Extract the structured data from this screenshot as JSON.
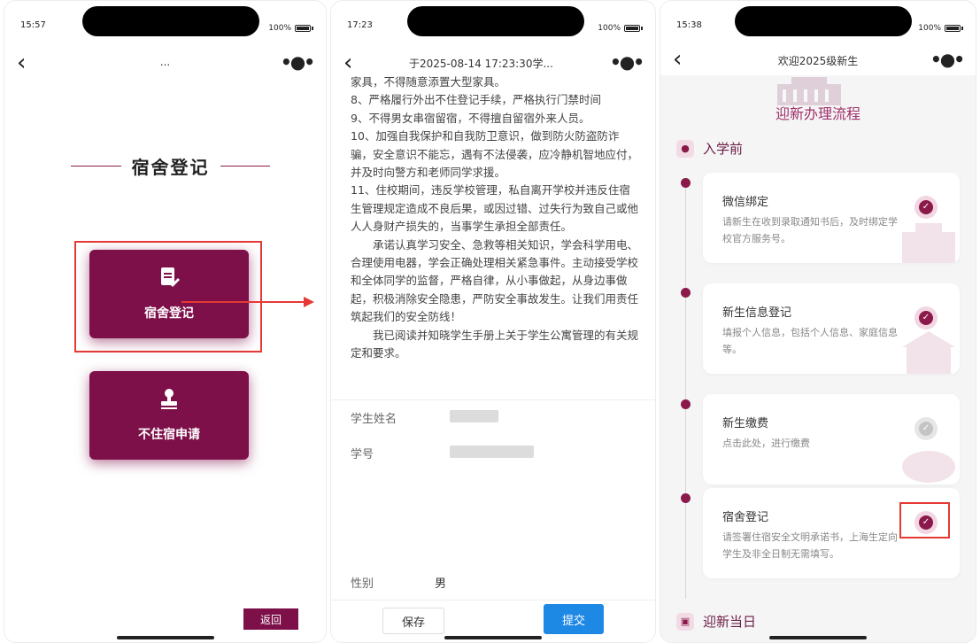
{
  "phone1": {
    "time": "15:57",
    "battery": "100%",
    "nav_title": "...",
    "section_title": "宿舍登记",
    "tiles": [
      {
        "label": "宿舍登记",
        "icon": "edit-doc-icon"
      },
      {
        "label": "不住宿申请",
        "icon": "stamp-icon"
      }
    ],
    "back_button": "返回"
  },
  "phone2": {
    "time": "17:23",
    "battery": "100%",
    "nav_title": "于2025-08-14 17:23:30学...",
    "paragraphs": [
      "家具，不得随意添置大型家具。",
      "8、严格履行外出不住登记手续，严格执行门禁时间",
      "9、不得男女串宿留宿，不得擅自留宿外来人员。",
      "10、加强自我保护和自我防卫意识，做到防火防盗防诈骗，安全意识不能忘，遇有不法侵袭，应冷静机智地应付，并及时向警方和老师同学求援。",
      "11、住校期间，违反学校管理，私自离开学校并违反住宿生管理规定造成不良后果，或因过错、过失行为致自己或他人人身财产损失的，当事学生承担全部责任。"
    ],
    "indented_paragraphs": [
      "承诺认真学习安全、急救等相关知识，学会科学用电、合理使用电器，学会正确处理相关紧急事件。主动接受学校和全体同学的监督，严格自律，从小事做起，从身边事做起，积极消除安全隐患，严防安全事故发生。让我们用责任筑起我们的安全防线！",
      "我已阅读并知晓学生手册上关于学生公寓管理的有关规定和要求。"
    ],
    "form": {
      "name_label": "学生姓名",
      "id_label": "学号",
      "gender_label": "性别",
      "gender_value": "男"
    },
    "save_button": "保存",
    "submit_button": "提交"
  },
  "phone3": {
    "time": "15:38",
    "battery": "100%",
    "nav_title": "欢迎2025级新生",
    "banner_title": "迎新办理流程",
    "section_before": "入学前",
    "section_day": "迎新当日",
    "steps": [
      {
        "title": "微信绑定",
        "desc": "请新生在收到录取通知书后，及时绑定学校官方服务号。",
        "done": true
      },
      {
        "title": "新生信息登记",
        "desc": "填报个人信息，包括个人信息、家庭信息等。",
        "done": true
      },
      {
        "title": "新生缴费",
        "desc": "点击此处，进行缴费",
        "done": false
      },
      {
        "title": "宿舍登记",
        "desc": "请签署住宿安全文明承诺书，上海生定向学生及非全日制无需填写。",
        "done": true
      }
    ]
  },
  "colors": {
    "brand": "#7d0f49",
    "accent_blue": "#1e88e5",
    "highlight_red": "#e53935"
  }
}
